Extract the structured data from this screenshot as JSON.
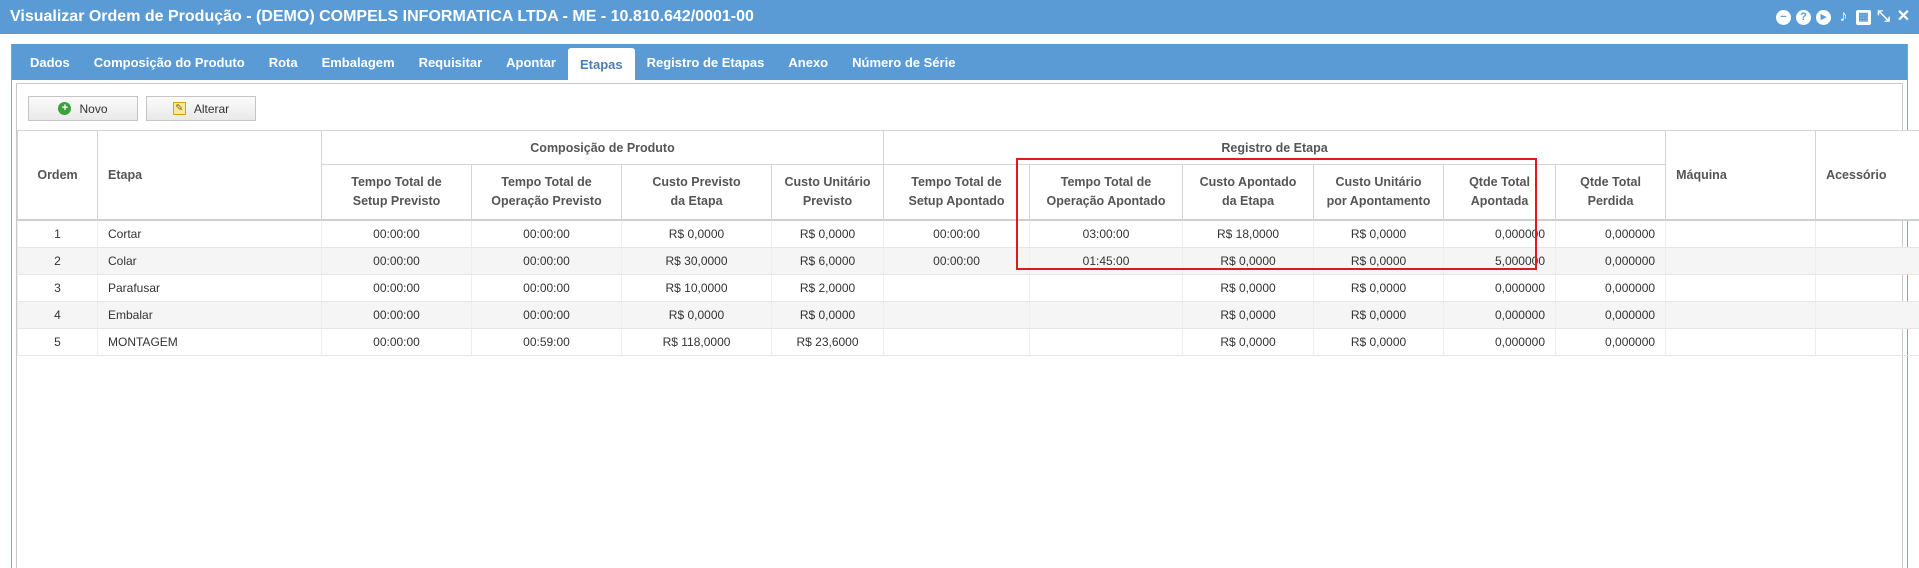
{
  "window": {
    "title": "Visualizar Ordem de Produção - (DEMO) COMPELS INFORMATICA LTDA - ME - 10.810.642/0001-00",
    "controls": [
      "minus-icon",
      "help-icon",
      "play-icon",
      "bell-icon",
      "calendar-icon",
      "shrink-icon",
      "close-icon"
    ]
  },
  "tabs": [
    {
      "label": "Dados"
    },
    {
      "label": "Composição do Produto"
    },
    {
      "label": "Rota"
    },
    {
      "label": "Embalagem"
    },
    {
      "label": "Requisitar"
    },
    {
      "label": "Apontar"
    },
    {
      "label": "Etapas",
      "active": true
    },
    {
      "label": "Registro de Etapas"
    },
    {
      "label": "Anexo"
    },
    {
      "label": "Número de Série"
    }
  ],
  "toolbar": {
    "new_label": "Novo",
    "edit_label": "Alterar"
  },
  "table": {
    "groups": {
      "composicao": "Composição de Produto",
      "registro": "Registro de Etapa"
    },
    "headers": {
      "ordem": "Ordem",
      "etapa": "Etapa",
      "setup_prev": [
        "Tempo Total de",
        "Setup Previsto"
      ],
      "oper_prev": [
        "Tempo Total de",
        "Operação Previsto"
      ],
      "custo_prev": [
        "Custo Previsto",
        "da Etapa"
      ],
      "custo_unit_prev": [
        "Custo Unitário",
        "Previsto"
      ],
      "setup_apont": [
        "Tempo Total de",
        "Setup Apontado"
      ],
      "oper_apont": [
        "Tempo Total de",
        "Operação Apontado"
      ],
      "custo_apont": [
        "Custo Apontado",
        "da Etapa"
      ],
      "custo_unit_apont": [
        "Custo Unitário",
        "por Apontamento"
      ],
      "qtde_apont": [
        "Qtde Total",
        "Apontada"
      ],
      "qtde_perdida": [
        "Qtde Total",
        "Perdida"
      ],
      "maquina": "Máquina",
      "acessorio": "Acessório"
    },
    "rows": [
      [
        "1",
        "Cortar",
        "00:00:00",
        "00:00:00",
        "R$ 0,0000",
        "R$ 0,0000",
        "00:00:00",
        "03:00:00",
        "R$ 18,0000",
        "R$ 0,0000",
        "0,000000",
        "0,000000",
        "",
        ""
      ],
      [
        "2",
        "Colar",
        "00:00:00",
        "00:00:00",
        "R$ 30,0000",
        "R$ 6,0000",
        "00:00:00",
        "01:45:00",
        "R$ 0,0000",
        "R$ 0,0000",
        "5,000000",
        "0,000000",
        "",
        ""
      ],
      [
        "3",
        "Parafusar",
        "00:00:00",
        "00:00:00",
        "R$ 10,0000",
        "R$ 2,0000",
        "",
        "",
        "R$ 0,0000",
        "R$ 0,0000",
        "0,000000",
        "0,000000",
        "",
        ""
      ],
      [
        "4",
        "Embalar",
        "00:00:00",
        "00:00:00",
        "R$ 0,0000",
        "R$ 0,0000",
        "",
        "",
        "R$ 0,0000",
        "R$ 0,0000",
        "0,000000",
        "0,000000",
        "",
        ""
      ],
      [
        "5",
        "MONTAGEM",
        "00:00:00",
        "00:59:00",
        "R$ 118,0000",
        "R$ 23,6000",
        "",
        "",
        "R$ 0,0000",
        "R$ 0,0000",
        "0,000000",
        "0,000000",
        "",
        ""
      ]
    ]
  },
  "highlight_color": "#e4161f"
}
